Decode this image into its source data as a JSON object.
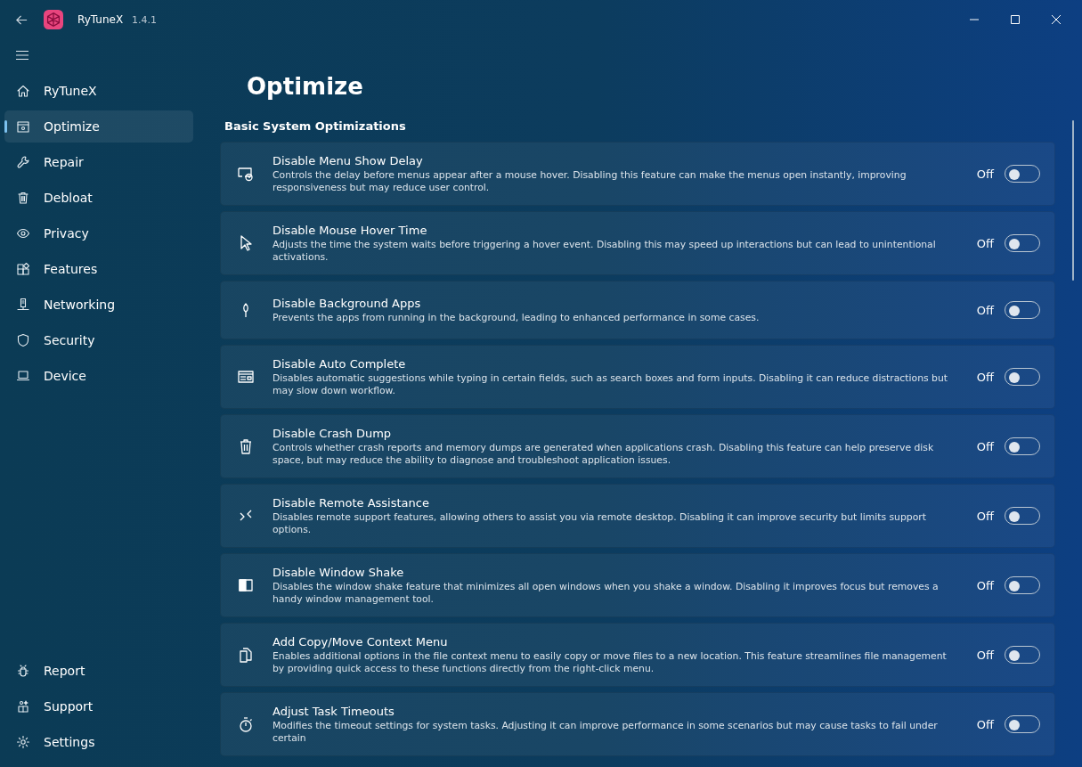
{
  "window": {
    "app_name": "RyTuneX",
    "version": "1.4.1"
  },
  "nav": [
    {
      "label": "RyTuneX",
      "selected": false
    },
    {
      "label": "Optimize",
      "selected": true
    },
    {
      "label": "Repair",
      "selected": false
    },
    {
      "label": "Debloat",
      "selected": false
    },
    {
      "label": "Privacy",
      "selected": false
    },
    {
      "label": "Features",
      "selected": false
    },
    {
      "label": "Networking",
      "selected": false
    },
    {
      "label": "Security",
      "selected": false
    },
    {
      "label": "Device",
      "selected": false
    }
  ],
  "footer_nav": [
    {
      "label": "Report",
      "selected": false
    },
    {
      "label": "Support",
      "selected": false
    },
    {
      "label": "Settings",
      "selected": false
    }
  ],
  "page_title": "Optimize",
  "section_heading": "Basic System Optimizations",
  "settings": [
    {
      "title": "Disable Menu Show Delay",
      "description": "Controls the delay before menus appear after a mouse hover. Disabling this feature can make the menus open instantly, improving responsiveness but may reduce user control.",
      "state_label": "Off",
      "on": false
    },
    {
      "title": "Disable Mouse Hover Time",
      "description": "Adjusts the time the system waits before triggering a hover event. Disabling this may speed up interactions but can lead to unintentional activations.",
      "state_label": "Off",
      "on": false
    },
    {
      "title": "Disable Background Apps",
      "description": "Prevents the apps from running in the background, leading to enhanced performance in some cases.",
      "state_label": "Off",
      "on": false
    },
    {
      "title": "Disable Auto Complete",
      "description": "Disables automatic suggestions while typing in certain fields, such as search boxes and form inputs. Disabling it can reduce distractions but may slow down workflow.",
      "state_label": "Off",
      "on": false
    },
    {
      "title": "Disable Crash Dump",
      "description": "Controls whether crash reports and memory dumps are generated when applications crash. Disabling this feature can help preserve disk space, but may reduce the ability to diagnose and troubleshoot application issues.",
      "state_label": "Off",
      "on": false
    },
    {
      "title": "Disable Remote Assistance",
      "description": "Disables remote support features, allowing others to assist you via remote desktop. Disabling it can improve security but limits support options.",
      "state_label": "Off",
      "on": false
    },
    {
      "title": "Disable Window Shake",
      "description": "Disables the window shake feature that minimizes all open windows when you shake a window. Disabling it improves focus but removes a handy window management tool.",
      "state_label": "Off",
      "on": false
    },
    {
      "title": "Add Copy/Move Context Menu",
      "description": "Enables additional options in the file context menu to easily copy or move files to a new location. This feature streamlines file management by providing quick access to these functions directly from the right-click menu.",
      "state_label": "Off",
      "on": false
    },
    {
      "title": "Adjust Task Timeouts",
      "description": "Modifies the timeout settings for system tasks. Adjusting it can improve performance in some scenarios but may cause tasks to fail under certain",
      "state_label": "Off",
      "on": false
    }
  ]
}
